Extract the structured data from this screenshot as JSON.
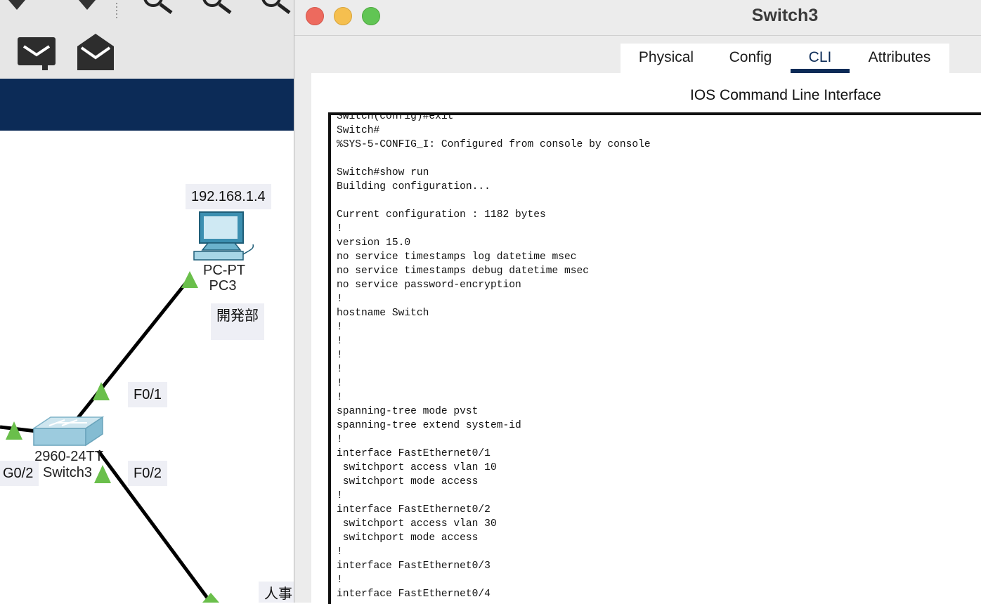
{
  "main_window": {
    "banner_color": "#0c2b57",
    "devices": {
      "pc3": {
        "ip": "192.168.1.4",
        "model": "PC-PT",
        "name": "PC3",
        "department": "開発部"
      },
      "switch3": {
        "model": "2960-24TT",
        "name": "Switch3"
      }
    },
    "port_labels": {
      "f0_1": "F0/1",
      "f0_2": "F0/2",
      "g0_2": "G0/2"
    },
    "bottom_label": "人事",
    "link_status_color": "#6abf4b",
    "toolbar_icons": [
      "note-icon",
      "open-envelope-icon",
      "magnifier-icon"
    ]
  },
  "device_window": {
    "title": "Switch3",
    "tabs": {
      "physical": "Physical",
      "config": "Config",
      "cli": "CLI",
      "attributes": "Attributes"
    },
    "active_tab": "CLI",
    "panel_heading": "IOS Command Line Interface",
    "console_lines": [
      "Switch(config)#exit",
      "Switch#",
      "%SYS-5-CONFIG_I: Configured from console by console",
      "",
      "Switch#show run",
      "Building configuration...",
      "",
      "Current configuration : 1182 bytes",
      "!",
      "version 15.0",
      "no service timestamps log datetime msec",
      "no service timestamps debug datetime msec",
      "no service password-encryption",
      "!",
      "hostname Switch",
      "!",
      "!",
      "!",
      "!",
      "!",
      "!",
      "spanning-tree mode pvst",
      "spanning-tree extend system-id",
      "!",
      "interface FastEthernet0/1",
      " switchport access vlan 10",
      " switchport mode access",
      "!",
      "interface FastEthernet0/2",
      " switchport access vlan 30",
      " switchport mode access",
      "!",
      "interface FastEthernet0/3",
      "!",
      "interface FastEthernet0/4"
    ]
  }
}
